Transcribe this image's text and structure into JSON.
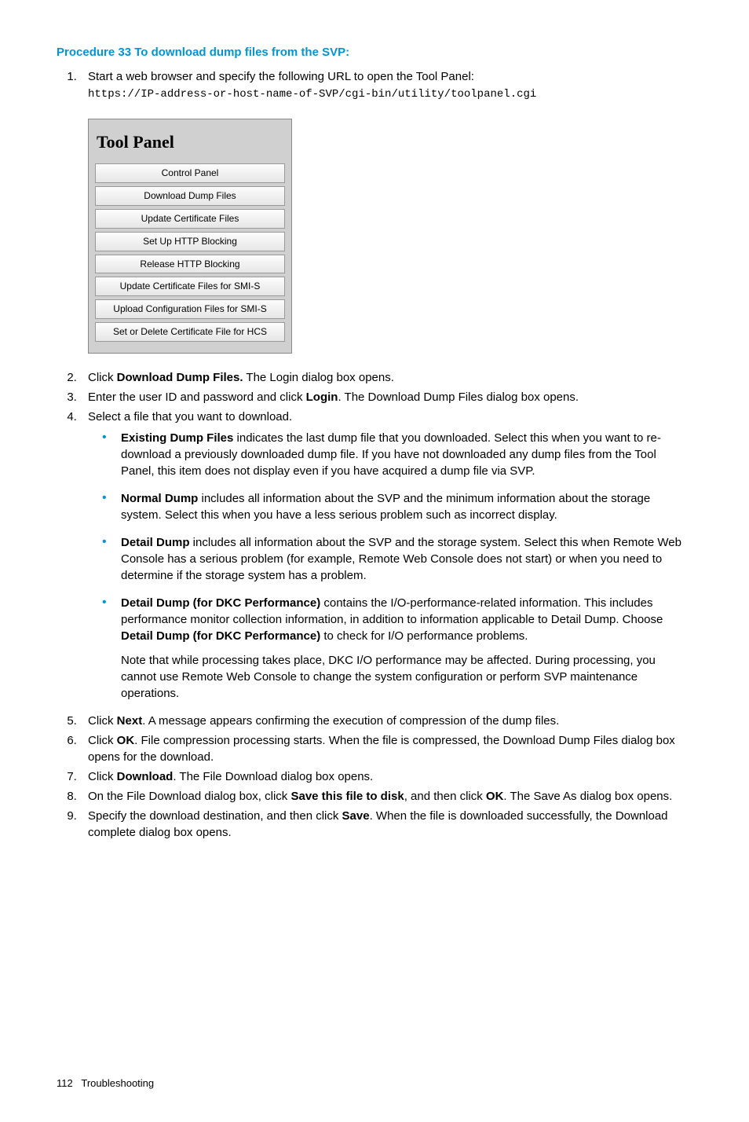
{
  "procedure_title": "Procedure 33 To download dump files from the SVP:",
  "steps": {
    "s1_a": "Start a web browser and specify the following URL to open the Tool Panel:",
    "s1_code": "https://IP-address-or-host-name-of-SVP/cgi-bin/utility/toolpanel.cgi",
    "s2_a": "Click ",
    "s2_b": "Download Dump Files.",
    "s2_c": " The Login dialog box opens.",
    "s3_a": "Enter the user ID and password and click ",
    "s3_b": "Login",
    "s3_c": ". The Download Dump Files dialog box opens.",
    "s4_a": "Select a file that you want to download.",
    "s5_a": "Click ",
    "s5_b": "Next",
    "s5_c": ". A message appears confirming the execution of compression of the dump files.",
    "s6_a": "Click ",
    "s6_b": "OK",
    "s6_c": ". File compression processing starts. When the file is compressed, the Download Dump Files dialog box opens for the download.",
    "s7_a": "Click ",
    "s7_b": "Download",
    "s7_c": ". The File Download dialog box opens.",
    "s8_a": "On the File Download dialog box, click ",
    "s8_b": "Save this file to disk",
    "s8_c": ", and then click ",
    "s8_d": "OK",
    "s8_e": ". The Save As dialog box opens.",
    "s9_a": "Specify the download destination, and then click ",
    "s9_b": "Save",
    "s9_c": ". When the file is downloaded successfully, the Download complete dialog box opens."
  },
  "tool_panel": {
    "title": "Tool Panel",
    "buttons": [
      "Control Panel",
      "Download Dump Files",
      "Update Certificate Files",
      "Set Up HTTP Blocking",
      "Release HTTP Blocking",
      "Update Certificate Files for SMI-S",
      "Upload Configuration Files for SMI-S",
      "Set or Delete Certificate File for HCS"
    ]
  },
  "bullets": {
    "b1_a": "Existing Dump Files",
    "b1_b": " indicates the last dump file that you downloaded. Select this when you want to re-download a previously downloaded dump file. If you have not downloaded any dump files from the Tool Panel, this item does not display even if you have acquired a dump file via SVP.",
    "b2_a": "Normal Dump",
    "b2_b": " includes all information about the SVP and the minimum information about the storage system. Select this when you have a less serious problem such as incorrect display.",
    "b3_a": "Detail Dump",
    "b3_b": " includes all information about the SVP and the storage system. Select this when Remote Web Console has a serious problem (for example, Remote Web Console does not start) or when you need to determine if the storage system has a problem.",
    "b4_a": "Detail Dump (for DKC Performance)",
    "b4_b": " contains the I/O-performance-related information. This includes performance monitor collection information, in addition to information applicable to Detail Dump. Choose ",
    "b4_c": "Detail Dump (for DKC Performance)",
    "b4_d": "  to check for I/O performance problems.",
    "b4_note": "Note that while processing takes place, DKC I/O performance may be affected. During processing, you cannot use Remote Web Console to change the system configuration or perform SVP maintenance operations."
  },
  "footer": {
    "page": "112",
    "section": "Troubleshooting"
  }
}
